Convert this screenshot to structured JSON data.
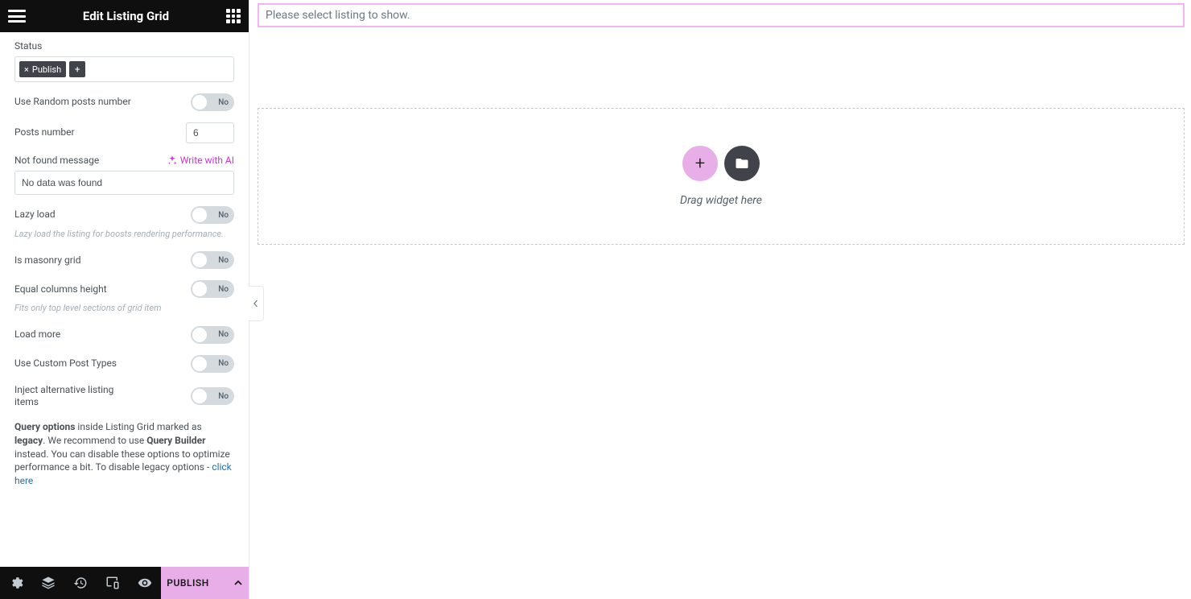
{
  "sidebar": {
    "title": "Edit Listing Grid",
    "status": {
      "label": "Status",
      "tag": "Publish"
    },
    "random_posts": {
      "label": "Use Random posts number",
      "switch": "No"
    },
    "posts_number": {
      "label": "Posts number",
      "value": "6"
    },
    "not_found": {
      "label": "Not found message",
      "ai_label": "Write with AI",
      "value": "No data was found"
    },
    "lazy_load": {
      "label": "Lazy load",
      "switch": "No",
      "help": "Lazy load the listing for boosts rendering performance."
    },
    "masonry": {
      "label": "Is masonry grid",
      "switch": "No"
    },
    "equal_columns": {
      "label": "Equal columns height",
      "switch": "No",
      "help": "Fits only top level sections of grid item"
    },
    "load_more": {
      "label": "Load more",
      "switch": "No"
    },
    "custom_post_types": {
      "label": "Use Custom Post Types",
      "switch": "No"
    },
    "inject_alt": {
      "label": "Inject alternative listing items",
      "switch": "No"
    },
    "legacy": {
      "b1": "Query options",
      "t1": " inside Listing Grid marked as ",
      "b2": "legacy",
      "t2": ". We recommend to use ",
      "b3": "Query Builder",
      "t3": " instead. You can disable these options to optimize performance a bit. To disable legacy options - ",
      "link": "click here"
    },
    "publish": "PUBLISH"
  },
  "canvas": {
    "alert": "Please select listing to show.",
    "drop_text": "Drag widget here"
  }
}
